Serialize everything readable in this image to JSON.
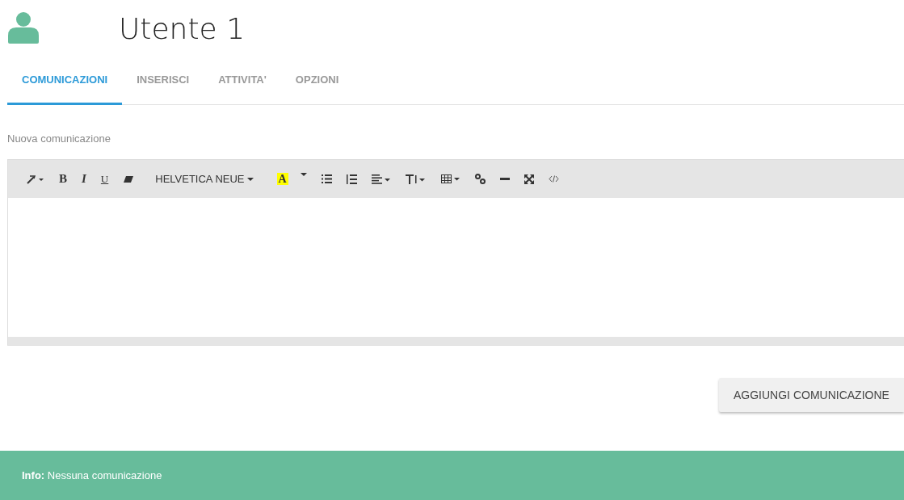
{
  "header": {
    "title": "Utente 1"
  },
  "tabs": [
    {
      "label": "COMUNICAZIONI",
      "selected": true
    },
    {
      "label": "INSERISCI",
      "selected": false
    },
    {
      "label": "ATTIVITA'",
      "selected": false
    },
    {
      "label": "OPZIONI",
      "selected": false
    }
  ],
  "editor": {
    "label": "Nuova comunicazione",
    "toolbar": {
      "bold": "B",
      "italic": "I",
      "underline": "U",
      "font": "HELVETICA NEUE",
      "highlight_letter": "A"
    }
  },
  "add_button": "AGGIUNGI COMUNICAZIONE",
  "info": {
    "label": "Info:",
    "text": "Nessuna comunicazione"
  }
}
